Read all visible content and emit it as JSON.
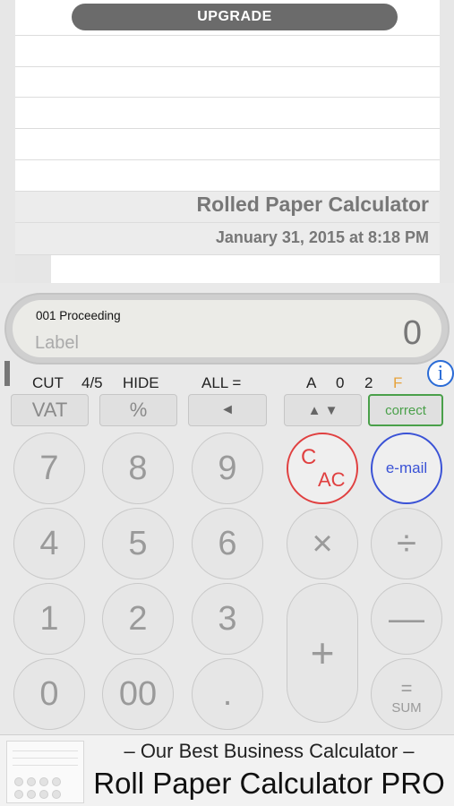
{
  "paper": {
    "upgrade_label": "UPGRADE",
    "title": "Rolled Paper Calculator",
    "date": "January 31, 2015 at 8:18 PM"
  },
  "display": {
    "entry_label": "001 Proceeding",
    "label_placeholder": "Label",
    "value": "0"
  },
  "settings": {
    "cut_label": "CUT",
    "round_label": "4/5",
    "hide_label": "HIDE",
    "all_label": "ALL =",
    "a_label": "A",
    "zero_label": "0",
    "two_label": "2",
    "f_label": "F",
    "info_label": "i",
    "f_color": "#e6a23c"
  },
  "function_keys": {
    "vat": "VAT",
    "percent": "%",
    "backspace": "◄",
    "up_down": "▲ ▼",
    "correct": "correct"
  },
  "keys": {
    "seven": "7",
    "eight": "8",
    "nine": "9",
    "four": "4",
    "five": "5",
    "six": "6",
    "one": "1",
    "two": "2",
    "three": "3",
    "zero": "0",
    "double_zero": "00",
    "decimal": ".",
    "c_label": "C",
    "ac_label": "AC",
    "email": "e-mail",
    "multiply": "×",
    "divide": "÷",
    "minus": "—",
    "plus": "+",
    "sum_eq": "=",
    "sum_label": "SUM"
  },
  "colors": {
    "cac": "#e04040",
    "email": "#3a52d6",
    "correct": "#4aa04a",
    "info": "#2a6bd6"
  },
  "ad": {
    "subtitle": "– Our Best Business Calculator –",
    "title": "Roll Paper Calculator PRO"
  }
}
